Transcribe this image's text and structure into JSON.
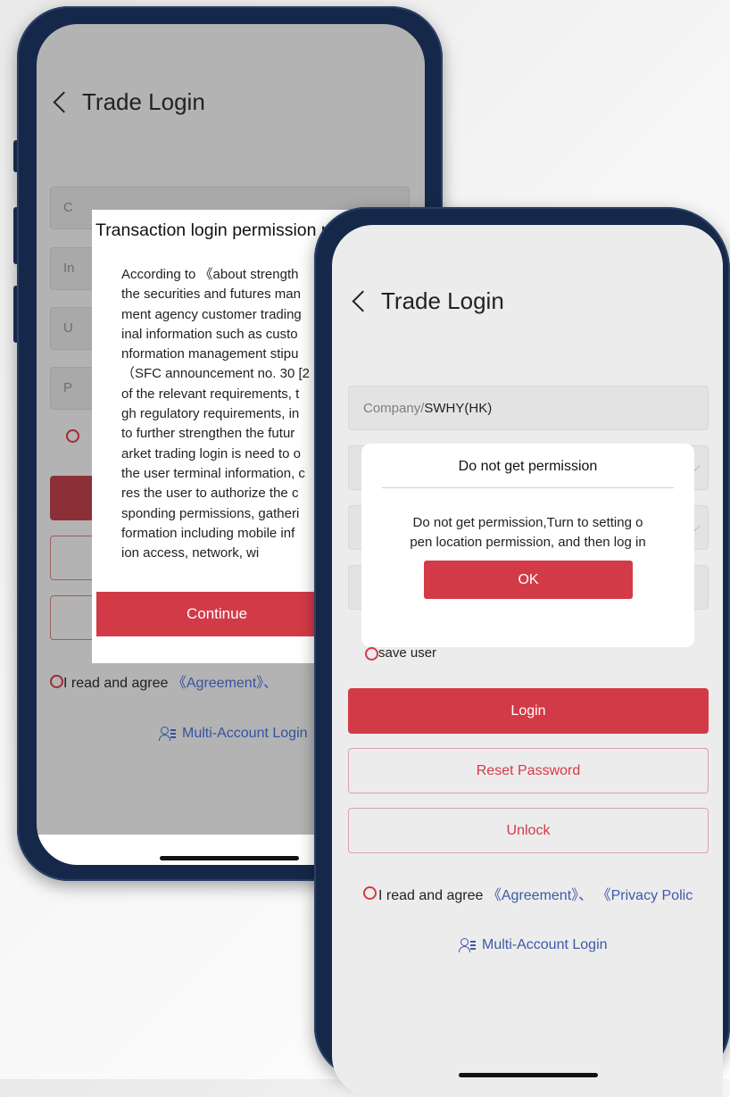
{
  "back_phone": {
    "title": "Trade Login",
    "dialog": {
      "title": "Transaction login permission p",
      "body_lines": [
        "According to 《about strength",
        "the securities and futures man",
        "ment agency customer trading",
        "inal information such as custo",
        "nformation management stipu",
        "（SFC announcement no. 30 [2",
        "of the relevant requirements, t",
        "gh regulatory requirements, in",
        "to further strengthen the futur",
        "arket trading login is need to o",
        "the user terminal information, c",
        "res the user to authorize the c",
        "sponding permissions, gatheri",
        "formation including mobile inf",
        "ion access, network, wi"
      ],
      "continue_label": "Continue"
    },
    "field_letters": [
      "C",
      "In",
      "U",
      "P"
    ],
    "agree_prefix": "I read and agree",
    "agree_link": "《Agreement》、",
    "multi_account": "Multi-Account Login"
  },
  "front_phone": {
    "title": "Trade Login",
    "company_label": "Company/",
    "company_value": "SWHY(HK)",
    "alert": {
      "title": "Do not get permission",
      "message_lines": [
        "Do not get permission,Turn to setting o",
        "pen location permission, and then log in"
      ],
      "ok_label": "OK"
    },
    "save_user": "save user",
    "login_label": "Login",
    "reset_label": "Reset Password",
    "unlock_label": "Unlock",
    "agree_prefix": "I read and agree",
    "agree_link": "《Agreement》、",
    "privacy_link": "《Privacy Polic",
    "multi_account": "Multi-Account Login"
  },
  "colors": {
    "accent_red": "#d33a47",
    "link_blue": "#3d5aa8",
    "frame": "#15284a"
  },
  "icons": [
    "back-chevron-icon",
    "multi-account-icon",
    "radio-icon",
    "dropdown-chevron-icon"
  ]
}
